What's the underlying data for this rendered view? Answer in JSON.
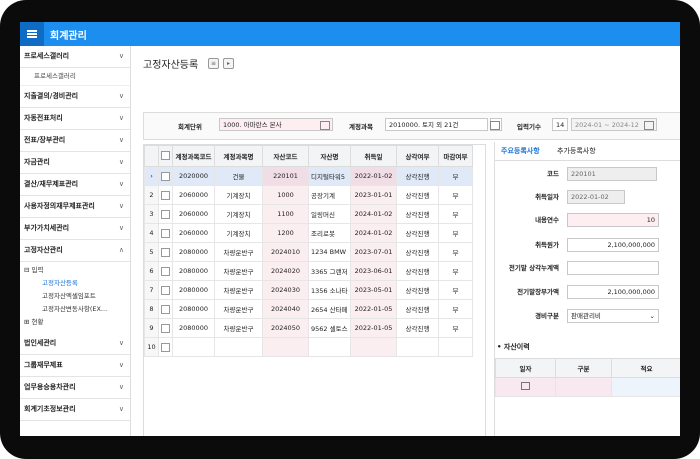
{
  "app": {
    "title": "회계관리"
  },
  "sidebar": {
    "items": [
      {
        "label": "프로세스갤러리",
        "chev": "∨",
        "sub": [
          "프로세스갤러리"
        ]
      },
      {
        "label": "지출결의/경비관리",
        "chev": "∨"
      },
      {
        "label": "자동전표처리",
        "chev": "∨"
      },
      {
        "label": "전표/장부관리",
        "chev": "∨"
      },
      {
        "label": "자금관리",
        "chev": "∨"
      },
      {
        "label": "결산/재무제표관리",
        "chev": "∨"
      },
      {
        "label": "사용자정의재무제표관리",
        "chev": "∨"
      },
      {
        "label": "부가가치세관리",
        "chev": "∨"
      },
      {
        "label": "고정자산관리",
        "chev": "∧"
      }
    ],
    "tree": {
      "input_label": "입력",
      "children": [
        "고정자산등록",
        "고정자산엑셀임포트",
        "고정자산변동사항(EX..."
      ],
      "status_label": "현황"
    },
    "items_after": [
      {
        "label": "법인세관리",
        "chev": "∨"
      },
      {
        "label": "그룹재무제표",
        "chev": "∨"
      },
      {
        "label": "업무용승용차관리",
        "chev": "∨"
      },
      {
        "label": "회계기초정보관리",
        "chev": "∨"
      }
    ]
  },
  "page": {
    "title": "고정자산등록"
  },
  "filter": {
    "unit_label": "회계단위",
    "unit_value": "1000. 아마란스 본사",
    "account_label": "계정과목",
    "account_value": "2010000. 토지 외 21건",
    "period_label": "입력기수",
    "period_no": "14",
    "period_range": "2024-01 ~ 2024-12"
  },
  "grid": {
    "headers": [
      "계정과목코드",
      "계정과목명",
      "자산코드",
      "자산명",
      "취득일",
      "상각여부",
      "마감여부"
    ],
    "rows": [
      {
        "no": "",
        "code": "2020000",
        "name": "건물",
        "asset_code": "220101",
        "asset_name": "디지털타워5",
        "date": "2022-01-02",
        "dep": "상각진행",
        "close": "부"
      },
      {
        "no": "2",
        "code": "2060000",
        "name": "기계장치",
        "asset_code": "1000",
        "asset_name": "공장기계",
        "date": "2023-01-01",
        "dep": "상각진행",
        "close": "부"
      },
      {
        "no": "3",
        "code": "2060000",
        "name": "기계장치",
        "asset_code": "1100",
        "asset_name": "일링머신",
        "date": "2024-01-02",
        "dep": "상각진행",
        "close": "부"
      },
      {
        "no": "4",
        "code": "2060000",
        "name": "기계장치",
        "asset_code": "1200",
        "asset_name": "조리로봇",
        "date": "2024-01-02",
        "dep": "상각진행",
        "close": "부"
      },
      {
        "no": "5",
        "code": "2080000",
        "name": "차량운반구",
        "asset_code": "2024010",
        "asset_name": "1234 BMW",
        "date": "2023-07-01",
        "dep": "상각진행",
        "close": "부"
      },
      {
        "no": "6",
        "code": "2080000",
        "name": "차량운반구",
        "asset_code": "2024020",
        "asset_name": "3365 그랜저",
        "date": "2023-06-01",
        "dep": "상각진행",
        "close": "부"
      },
      {
        "no": "7",
        "code": "2080000",
        "name": "차량운반구",
        "asset_code": "2024030",
        "asset_name": "1356 소나타",
        "date": "2023-05-01",
        "dep": "상각진행",
        "close": "부"
      },
      {
        "no": "8",
        "code": "2080000",
        "name": "차량운반구",
        "asset_code": "2024040",
        "asset_name": "2654 산타페",
        "date": "2022-01-05",
        "dep": "상각진행",
        "close": "부"
      },
      {
        "no": "9",
        "code": "2080000",
        "name": "차량운반구",
        "asset_code": "2024050",
        "asset_name": "9562 셀토스",
        "date": "2022-01-05",
        "dep": "상각진행",
        "close": "부"
      },
      {
        "no": "10",
        "code": "",
        "name": "",
        "asset_code": "",
        "asset_name": "",
        "date": "",
        "dep": "",
        "close": ""
      }
    ],
    "selected_marker": "›"
  },
  "detail": {
    "tab_main": "주요등록사항",
    "tab_extra": "추가등록사항",
    "fields": [
      {
        "label": "코드",
        "value": "220101"
      },
      {
        "label": "취득일자",
        "value": "2022-01-02"
      },
      {
        "label": "내용연수",
        "value": "10"
      },
      {
        "label": "취득원가",
        "value": "2,100,000,000"
      },
      {
        "label": "전기말 상각누계액",
        "value": ""
      },
      {
        "label": "전기말장부가액",
        "value": "2,100,000,000"
      },
      {
        "label": "경비구분",
        "value": "판매관리비"
      }
    ],
    "history_title": "• 자산이력",
    "history_headers": [
      "일자",
      "구분",
      "적요"
    ]
  }
}
